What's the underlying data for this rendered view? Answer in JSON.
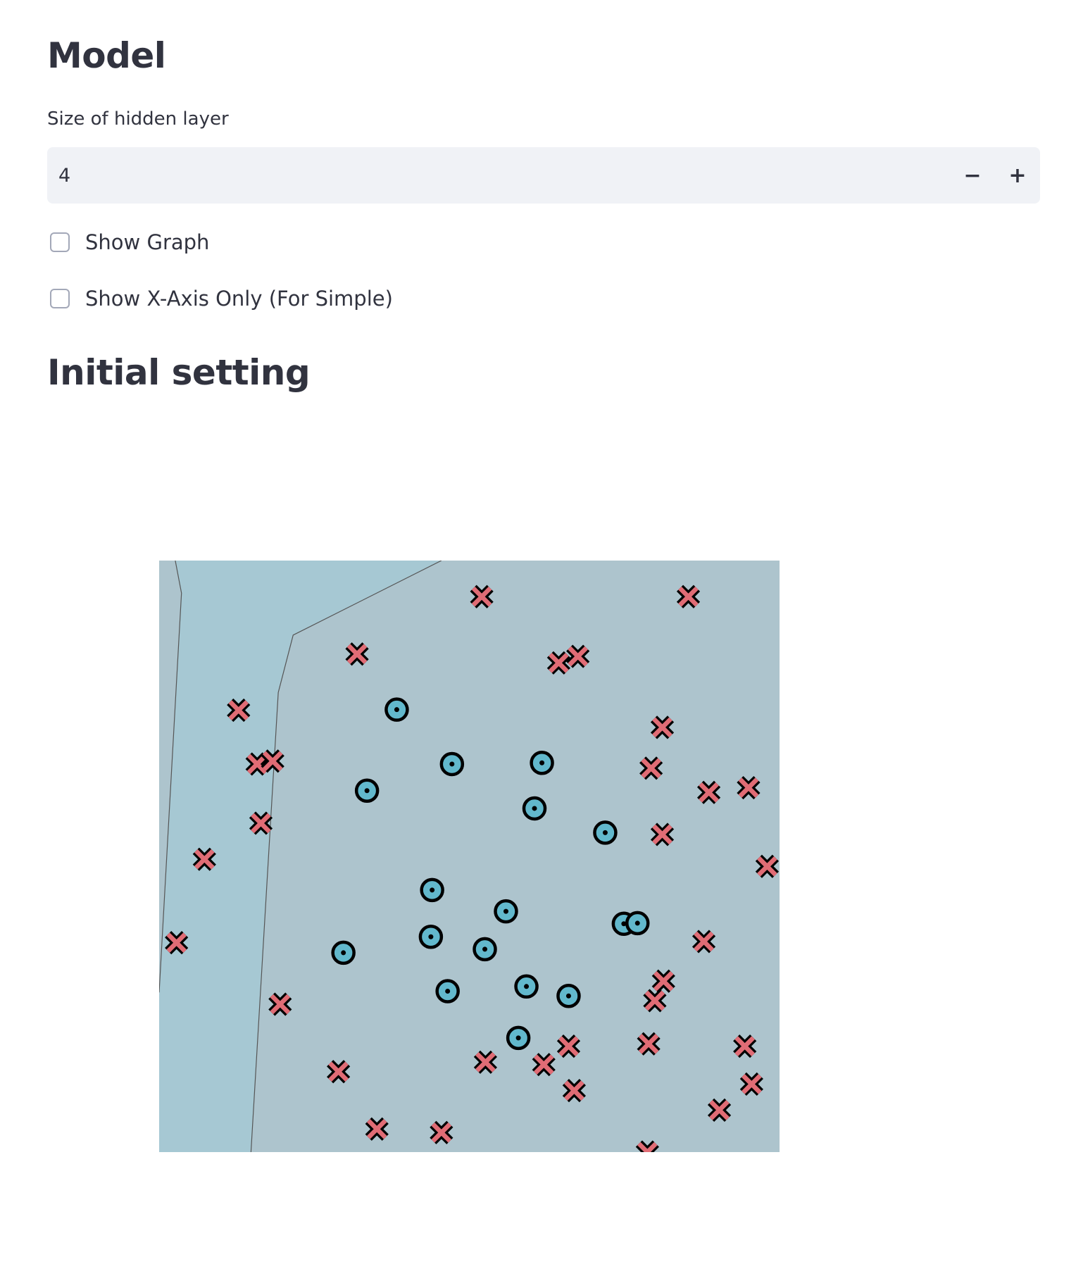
{
  "headings": {
    "model": "Model",
    "initial": "Initial setting"
  },
  "hidden_layer": {
    "label": "Size of hidden layer",
    "value": "4",
    "decrement_label": "−",
    "increment_label": "+"
  },
  "checkboxes": {
    "show_graph": {
      "label": "Show Graph",
      "checked": false
    },
    "show_x_axis": {
      "label": "Show X-Axis Only (For Simple)",
      "checked": false
    }
  },
  "chart_data": {
    "type": "scatter",
    "xlim": [
      0,
      1
    ],
    "ylim": [
      0,
      1
    ],
    "grid": false,
    "axes_visible": false,
    "region_colors": {
      "region_a": "#a6c8d3",
      "region_b": "#adc4cd",
      "boundary": "#555555"
    },
    "decision_boundary": [
      {
        "name": "boundary-1",
        "points": [
          [
            0.026,
            1.0
          ],
          [
            0.036,
            0.945
          ],
          [
            0.0,
            0.27
          ]
        ]
      },
      {
        "name": "boundary-2",
        "points": [
          [
            0.455,
            1.0
          ],
          [
            0.216,
            0.874
          ],
          [
            0.192,
            0.777
          ],
          [
            0.148,
            0.0
          ]
        ]
      }
    ],
    "series": [
      {
        "marker": "x",
        "color": "#e06c75",
        "points": [
          [
            0.52,
            0.939
          ],
          [
            0.853,
            0.939
          ],
          [
            0.319,
            0.842
          ],
          [
            0.644,
            0.827
          ],
          [
            0.675,
            0.838
          ],
          [
            0.128,
            0.747
          ],
          [
            0.811,
            0.718
          ],
          [
            0.158,
            0.656
          ],
          [
            0.183,
            0.661
          ],
          [
            0.793,
            0.649
          ],
          [
            0.886,
            0.608
          ],
          [
            0.95,
            0.616
          ],
          [
            0.164,
            0.556
          ],
          [
            0.073,
            0.495
          ],
          [
            0.811,
            0.537
          ],
          [
            0.98,
            0.483
          ],
          [
            0.028,
            0.354
          ],
          [
            0.878,
            0.356
          ],
          [
            0.813,
            0.289
          ],
          [
            0.799,
            0.256
          ],
          [
            0.195,
            0.25
          ],
          [
            0.789,
            0.183
          ],
          [
            0.66,
            0.179
          ],
          [
            0.944,
            0.179
          ],
          [
            0.289,
            0.136
          ],
          [
            0.526,
            0.152
          ],
          [
            0.62,
            0.148
          ],
          [
            0.669,
            0.104
          ],
          [
            0.955,
            0.115
          ],
          [
            0.903,
            0.071
          ],
          [
            0.351,
            0.039
          ],
          [
            0.455,
            0.033
          ],
          [
            0.787,
            0.0
          ]
        ]
      },
      {
        "marker": "circle-dot",
        "color": "#62b8cc",
        "points": [
          [
            0.383,
            0.748
          ],
          [
            0.472,
            0.656
          ],
          [
            0.617,
            0.658
          ],
          [
            0.335,
            0.611
          ],
          [
            0.605,
            0.581
          ],
          [
            0.719,
            0.54
          ],
          [
            0.44,
            0.443
          ],
          [
            0.559,
            0.407
          ],
          [
            0.749,
            0.386
          ],
          [
            0.771,
            0.387
          ],
          [
            0.438,
            0.364
          ],
          [
            0.525,
            0.343
          ],
          [
            0.297,
            0.337
          ],
          [
            0.465,
            0.272
          ],
          [
            0.592,
            0.28
          ],
          [
            0.66,
            0.264
          ],
          [
            0.579,
            0.193
          ]
        ]
      }
    ]
  }
}
